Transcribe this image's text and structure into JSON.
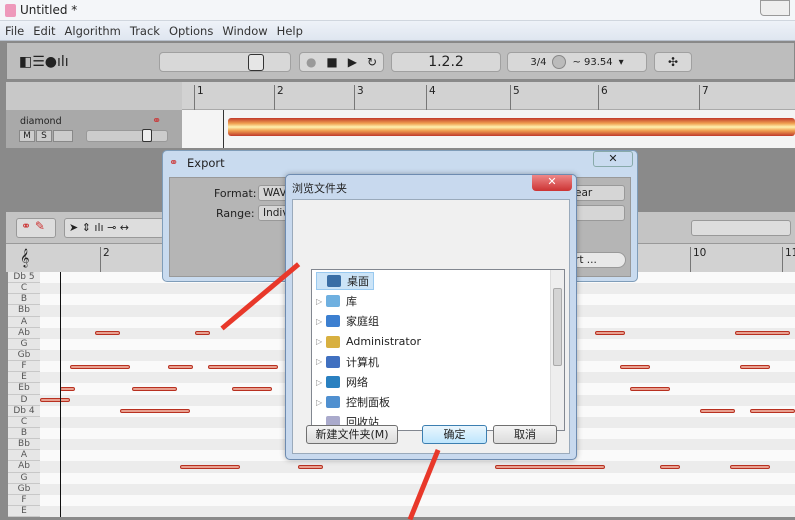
{
  "window": {
    "title": "Untitled *"
  },
  "menu": [
    "File",
    "Edit",
    "Algorithm",
    "Track",
    "Options",
    "Window",
    "Help"
  ],
  "transport": {
    "position": "1.2.2",
    "time_signature": "3/4",
    "tempo": "~ 93.54"
  },
  "arrangement": {
    "ruler": [
      "1",
      "2",
      "3",
      "4",
      "5",
      "6",
      "7"
    ],
    "track_name": "diamond",
    "mute": "M",
    "solo": "S"
  },
  "editor": {
    "ruler": [
      "2",
      "10",
      "11"
    ],
    "pitches": [
      "Db 5",
      "C",
      "B",
      "Bb",
      "A",
      "Ab",
      "G",
      "Gb",
      "F",
      "E",
      "Eb",
      "D",
      "Db 4",
      "C",
      "B",
      "Bb",
      "A",
      "Ab",
      "G",
      "Gb",
      "F",
      "E"
    ]
  },
  "export_dialog": {
    "title": "Export",
    "format_label": "Format:",
    "format_value": "WAV",
    "range_label": "Range:",
    "range_value": "Individ",
    "right_select": "ear",
    "export_button": "rt ..."
  },
  "browse_dialog": {
    "title": "浏览文件夹",
    "items": [
      {
        "label": "桌面",
        "selected": true
      },
      {
        "label": "库"
      },
      {
        "label": "家庭组"
      },
      {
        "label": "Administrator"
      },
      {
        "label": "计算机"
      },
      {
        "label": "网络"
      },
      {
        "label": "控制面板"
      },
      {
        "label": "回收站"
      }
    ],
    "new_folder": "新建文件夹(M)",
    "ok": "确定",
    "cancel": "取消"
  }
}
